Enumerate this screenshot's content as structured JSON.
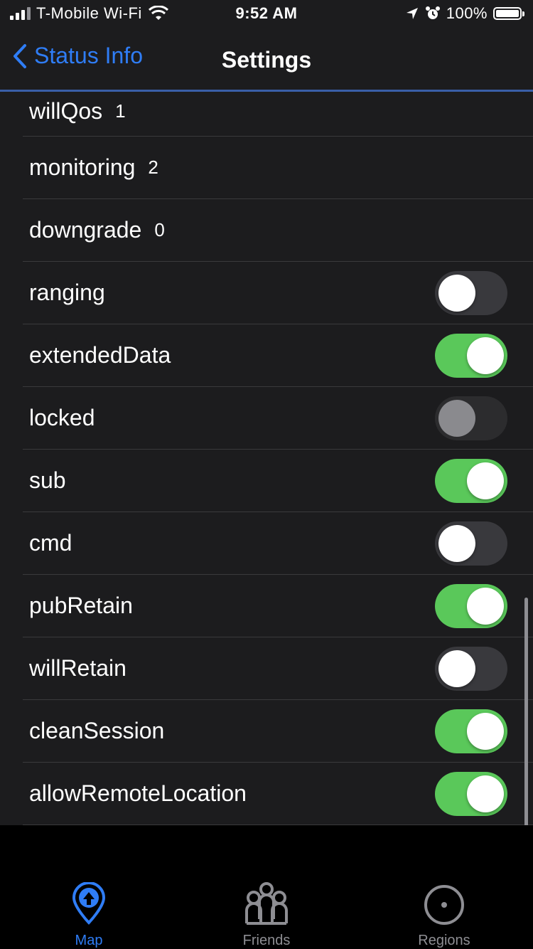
{
  "status_bar": {
    "carrier": "T-Mobile Wi-Fi",
    "time": "9:52 AM",
    "battery": "100%"
  },
  "nav": {
    "back_label": "Status Info",
    "title": "Settings"
  },
  "settings": {
    "values": [
      {
        "label": "willQos",
        "value": "1"
      },
      {
        "label": "monitoring",
        "value": "2"
      },
      {
        "label": "downgrade",
        "value": "0"
      }
    ],
    "toggles": [
      {
        "label": "ranging",
        "on": false
      },
      {
        "label": "extendedData",
        "on": true
      },
      {
        "label": "locked",
        "on": false,
        "disabled": true
      },
      {
        "label": "sub",
        "on": true
      },
      {
        "label": "cmd",
        "on": false
      },
      {
        "label": "pubRetain",
        "on": true
      },
      {
        "label": "willRetain",
        "on": false
      },
      {
        "label": "cleanSession",
        "on": true
      },
      {
        "label": "allowRemoteLocation",
        "on": true
      }
    ]
  },
  "tabs": [
    {
      "label": "Map",
      "icon": "map-pin-icon",
      "active": true
    },
    {
      "label": "Friends",
      "icon": "friends-icon",
      "active": false
    },
    {
      "label": "Regions",
      "icon": "regions-icon",
      "active": false
    }
  ],
  "colors": {
    "accent": "#2f7df6",
    "toggle_on": "#5ac85a",
    "background": "#1c1c1e"
  }
}
